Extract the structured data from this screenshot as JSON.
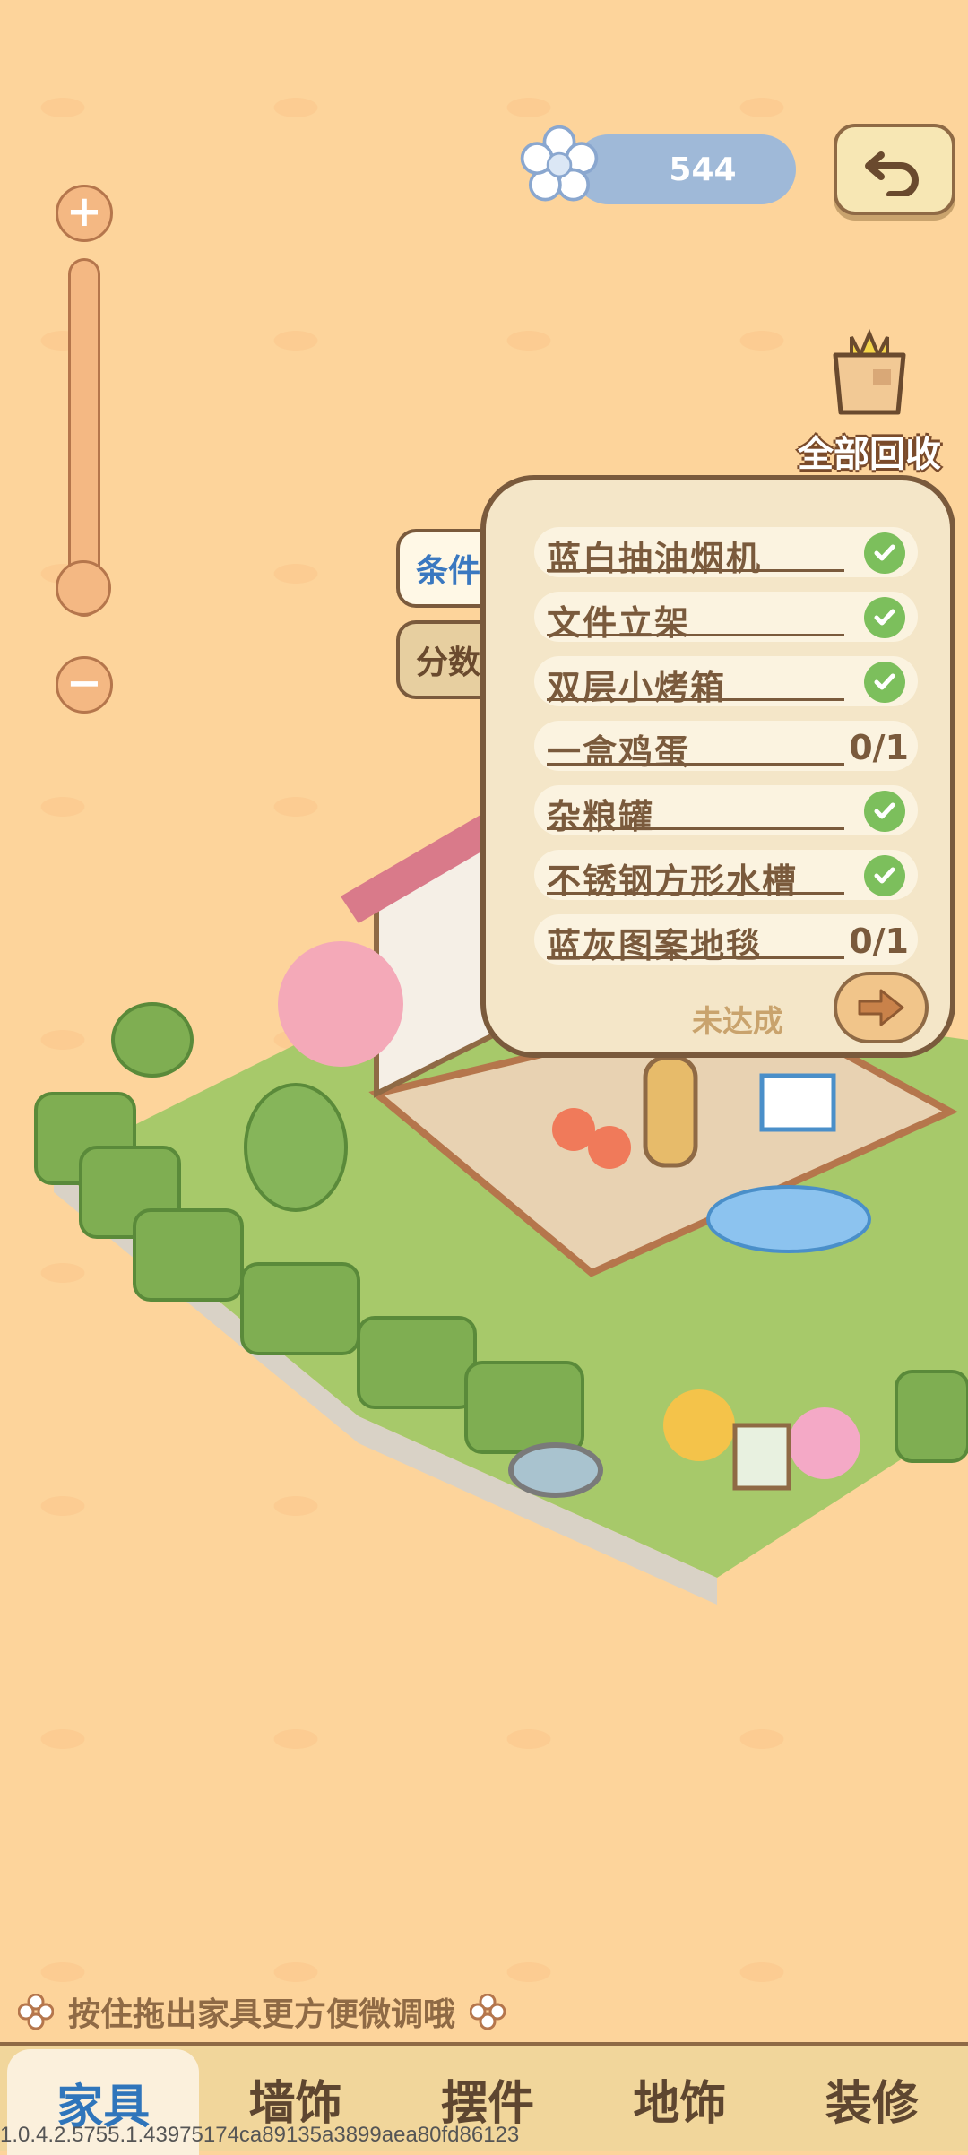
{
  "zoom": {
    "plus_label": "+",
    "minus_label": "−",
    "level": 0.1
  },
  "currency": {
    "icon": "flower-icon",
    "amount": "544"
  },
  "header": {
    "back_icon": "undo-icon",
    "recycle_label": "全部回收",
    "recycle_icon": "basket-icon"
  },
  "panel": {
    "tabs": [
      {
        "label": "条件",
        "active": true
      },
      {
        "label": "分数",
        "active": false
      }
    ],
    "conditions": [
      {
        "label": "蓝白抽油烟机",
        "done": true,
        "progress": ""
      },
      {
        "label": "文件立架",
        "done": true,
        "progress": ""
      },
      {
        "label": "双层小烤箱",
        "done": true,
        "progress": ""
      },
      {
        "label": "一盒鸡蛋",
        "done": false,
        "progress": "0/1"
      },
      {
        "label": "杂粮罐",
        "done": true,
        "progress": ""
      },
      {
        "label": "不锈钢方形水槽",
        "done": true,
        "progress": ""
      },
      {
        "label": "蓝灰图案地毯",
        "done": false,
        "progress": "0/1"
      }
    ],
    "status": "未达成",
    "next_icon": "arrow-right-icon"
  },
  "hint": "按住拖出家具更方便微调哦",
  "nav": [
    {
      "label": "家具",
      "active": true
    },
    {
      "label": "墙饰",
      "active": false
    },
    {
      "label": "摆件",
      "active": false
    },
    {
      "label": "地饰",
      "active": false
    },
    {
      "label": "装修",
      "active": false
    }
  ],
  "version": "1.0.4.2.5755.1.43975174ca89135a3899aea80fd86123",
  "colors": {
    "background": "#fdd49b",
    "accent_blue": "#2f75bb",
    "check_green": "#7cbf5c",
    "border_brown": "#7a5a3c"
  }
}
